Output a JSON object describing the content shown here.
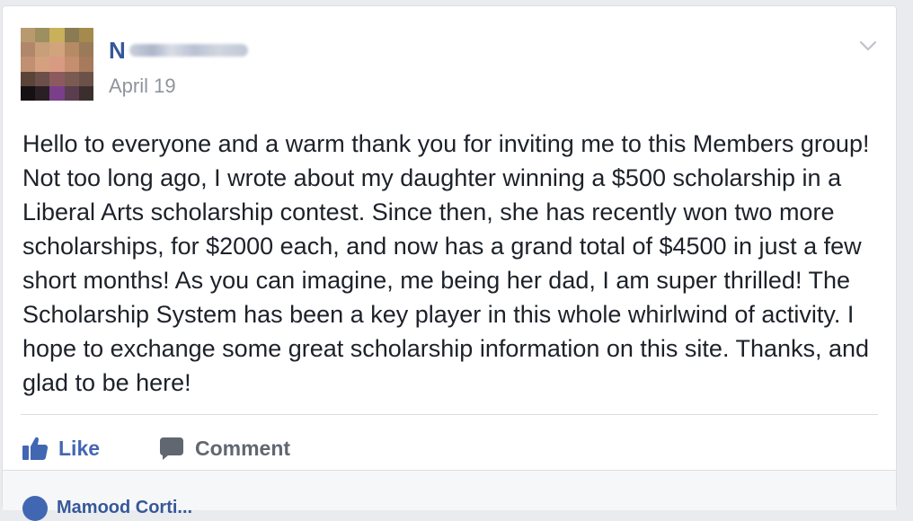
{
  "post": {
    "author": {
      "initial": "N",
      "name_blurred": true,
      "avatar_colors": [
        "#b89a6e",
        "#9d8f5f",
        "#c9b05a",
        "#8a7b52",
        "#a48a4c",
        "#b0876a",
        "#c79f78",
        "#d1a47d",
        "#b68a65",
        "#9a7a58",
        "#c18f72",
        "#d4a080",
        "#d99a84",
        "#c58e6e",
        "#a87a5c",
        "#5a4438",
        "#6b4f48",
        "#8c5a5e",
        "#7a5b52",
        "#6a5248",
        "#151113",
        "#2a1f24",
        "#7a3f8a",
        "#5a3d4f",
        "#3a2f2c"
      ]
    },
    "timestamp": "April 19",
    "text": "Hello to everyone and a warm thank you for inviting me to this Members group! Not too long ago, I wrote about my daughter winning a $500 scholarship in a Liberal Arts scholarship contest. Since then, she has recently won two more scholarships, for $2000 each, and now has a grand total of $4500 in just a few short months! As you can imagine, me being her dad, I am super thrilled! The Scholarship System has been a key player in this whole whirlwind of activity. I hope to exchange some great scholarship information on this site. Thanks, and glad to be here!",
    "actions": {
      "like_label": "Like",
      "like_icon": "thumbs-up-icon",
      "comment_label": "Comment",
      "comment_icon": "speech-bubble-icon"
    },
    "menu_icon": "chevron-down-icon"
  },
  "footer": {
    "commenter_name": "Mamood Corti..."
  },
  "colors": {
    "link_blue": "#365899",
    "like_blue": "#4267b2",
    "text": "#1d2129",
    "muted": "#90949c",
    "action_gray": "#616770"
  }
}
